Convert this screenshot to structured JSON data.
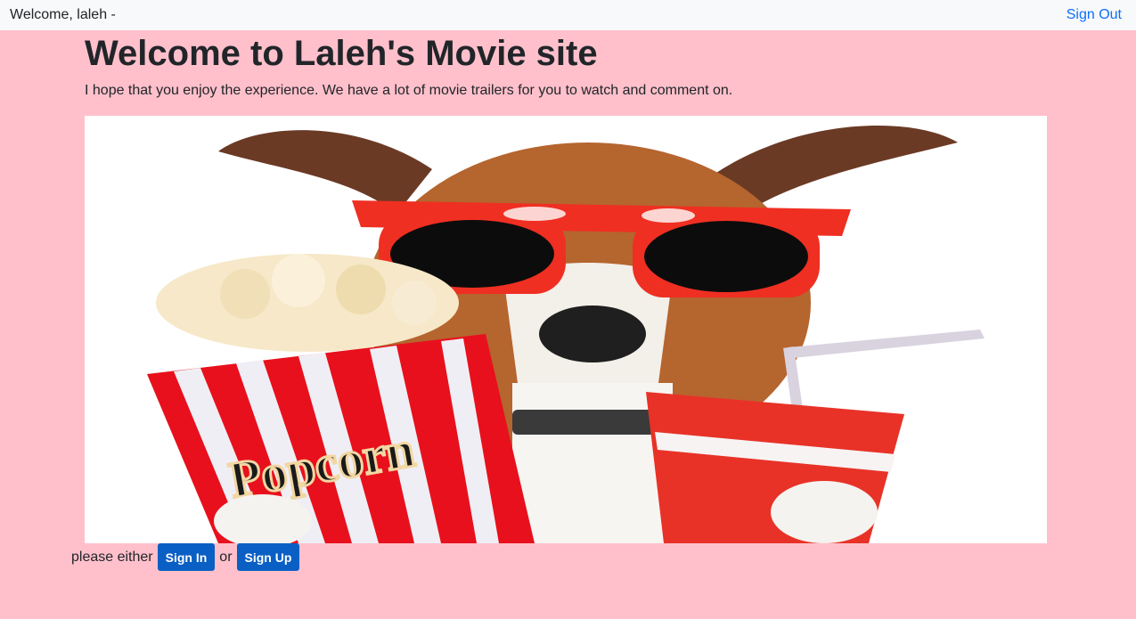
{
  "navbar": {
    "welcome_text": "Welcome, laleh -",
    "sign_out_label": "Sign Out"
  },
  "main": {
    "title": "Welcome to Laleh's Movie site",
    "subtitle": "I hope that you enjoy the experience. We have a lot of movie trailers for you to watch and comment on."
  },
  "hero_image": {
    "popcorn_text": "Popcorn"
  },
  "auth": {
    "prefix": "please either",
    "sign_in_label": "Sign In",
    "connector": "or",
    "sign_up_label": "Sign Up"
  },
  "colors": {
    "page_background": "#ffc0cb",
    "navbar_background": "#f8f9fa",
    "link": "#0d6efd",
    "button": "#0a5fc4"
  }
}
